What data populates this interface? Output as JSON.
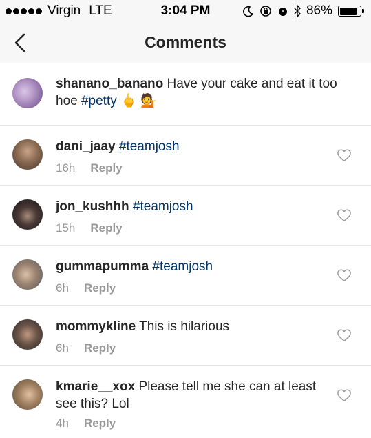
{
  "status_bar": {
    "carrier": "Virgin",
    "network": "LTE",
    "time": "3:04 PM",
    "battery_percent": "86%",
    "battery_level": 0.86
  },
  "nav": {
    "title": "Comments"
  },
  "caption": {
    "username": "shanano_banano",
    "text": "Have your cake and eat it too hoe",
    "hashtag": "#petty",
    "emoji": "🖕 💁"
  },
  "comments": [
    {
      "username": "dani_jaay",
      "text": "",
      "hashtag": "#teamjosh",
      "time": "16h",
      "reply_label": "Reply"
    },
    {
      "username": "jon_kushhh",
      "text": "",
      "hashtag": "#teamjosh",
      "time": "15h",
      "reply_label": "Reply"
    },
    {
      "username": "gummapumma",
      "text": "",
      "hashtag": "#teamjosh",
      "time": "6h",
      "reply_label": "Reply"
    },
    {
      "username": "mommykline",
      "text": "This is hilarious",
      "hashtag": "",
      "time": "6h",
      "reply_label": "Reply"
    },
    {
      "username": "kmarie__xox",
      "text": "Please tell me she can at least see this? Lol",
      "hashtag": "",
      "time": "4h",
      "reply_label": "Reply"
    }
  ],
  "colors": {
    "hashtag": "#003569",
    "meta": "#999999",
    "bar_bg": "#f7f7f7"
  },
  "icons": [
    "signal-dots-icon",
    "moon-icon",
    "rotation-lock-icon",
    "alarm-icon",
    "bluetooth-icon",
    "battery-icon",
    "back-chevron-icon",
    "heart-icon"
  ]
}
